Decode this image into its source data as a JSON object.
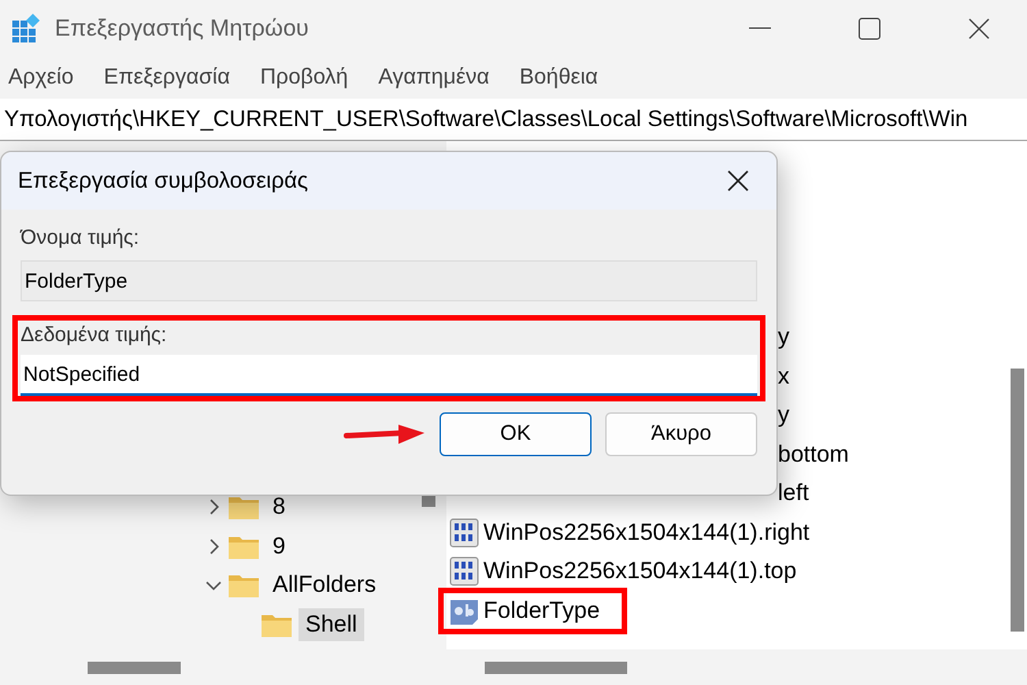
{
  "window": {
    "title": "Επεξεργαστής Μητρώου"
  },
  "menu": [
    {
      "label": "Αρχείο"
    },
    {
      "label": "Επεξεργασία"
    },
    {
      "label": "Προβολή"
    },
    {
      "label": "Αγαπημένα"
    },
    {
      "label": "Βοήθεια"
    }
  ],
  "address": "Υπολογιστής\\HKEY_CURRENT_USER\\Software\\Classes\\Local Settings\\Software\\Microsoft\\Win",
  "tree": [
    {
      "label": "8",
      "expanded": false,
      "selected": false
    },
    {
      "label": "9",
      "expanded": false,
      "selected": false
    },
    {
      "label": "AllFolders",
      "expanded": true,
      "selected": false,
      "children": [
        {
          "label": "Shell",
          "selected": true
        }
      ]
    }
  ],
  "values": [
    {
      "name": "y",
      "kind": "partial"
    },
    {
      "name": "x",
      "kind": "partial"
    },
    {
      "name": "y",
      "kind": "partial"
    },
    {
      "name": "bottom",
      "kind": "partial"
    },
    {
      "name": "left",
      "kind": "partial"
    },
    {
      "name": "WinPos2256x1504x144(1).right",
      "kind": "binary",
      "highlighted": false
    },
    {
      "name": "WinPos2256x1504x144(1).top",
      "kind": "binary",
      "highlighted": false
    },
    {
      "name": "FolderType",
      "kind": "string",
      "highlighted": true
    }
  ],
  "dialog": {
    "title": "Επεξεργασία συμβολοσειράς",
    "name_label": "Όνομα τιμής:",
    "name_value": "FolderType",
    "data_label": "Δεδομένα τιμής:",
    "data_value": "NotSpecified",
    "data_highlighted": true,
    "buttons": [
      {
        "label": "OK",
        "default": true,
        "arrow": true
      },
      {
        "label": "Άκυρο",
        "default": false,
        "arrow": false
      }
    ]
  }
}
